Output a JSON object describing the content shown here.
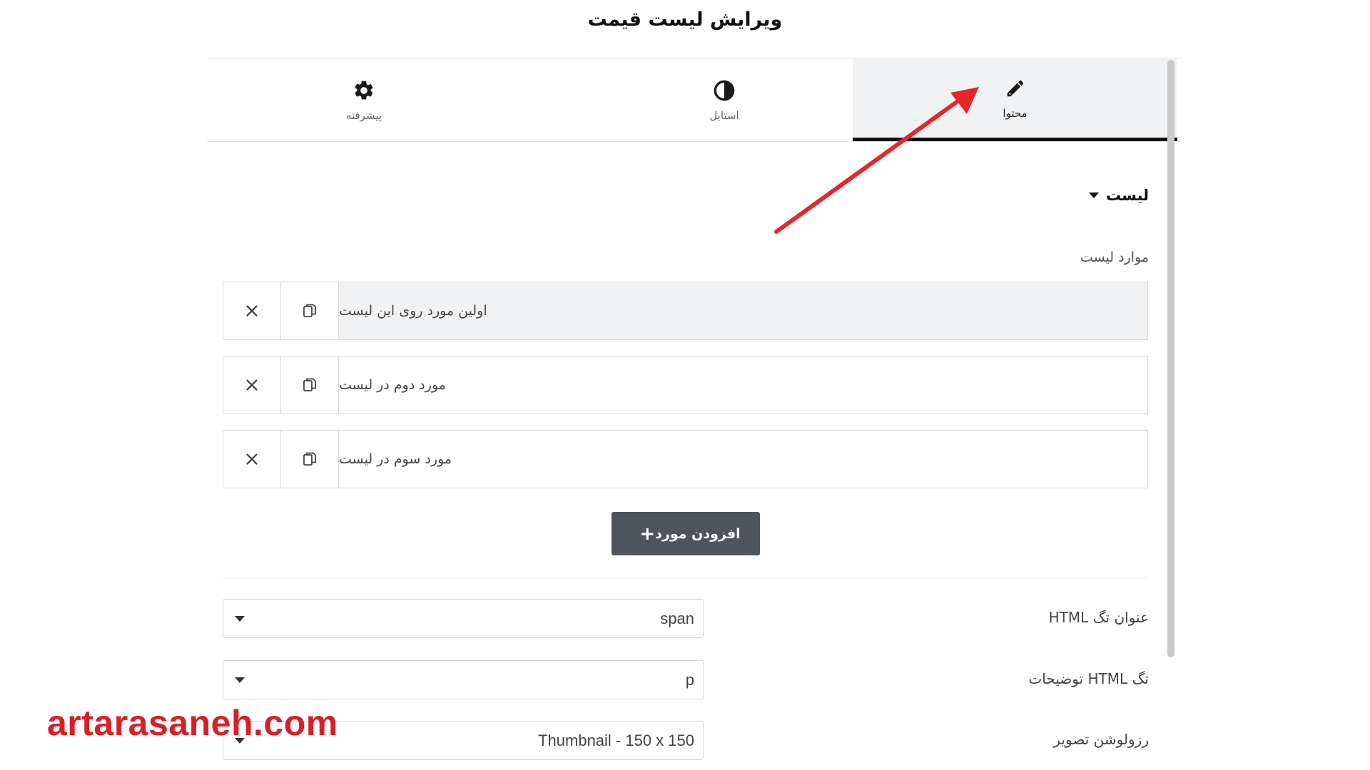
{
  "page_title": "ویرایش لیست قیمت",
  "tabs": [
    {
      "label": "محتوا",
      "icon": "pencil-icon",
      "active": true
    },
    {
      "label": "استایل",
      "icon": "contrast-icon",
      "active": false
    },
    {
      "label": "پیشرفته",
      "icon": "gear-icon",
      "active": false
    }
  ],
  "section": {
    "title": "لیست"
  },
  "items_label": "موارد لیست",
  "items": [
    {
      "title": "اولین مورد روی این لیست"
    },
    {
      "title": "مورد دوم در لیست"
    },
    {
      "title": "مورد سوم در لیست"
    }
  ],
  "add_button": {
    "label": "افزودن مورد"
  },
  "controls": [
    {
      "label": "عنوان تگ HTML",
      "value": "span"
    },
    {
      "label": "تگ HTML توضیحات",
      "value": "p"
    },
    {
      "label": "رزولوشن تصویر",
      "value": "Thumbnail - 150 x 150"
    }
  ],
  "watermark": "artarasaneh.com",
  "colors": {
    "annotation_arrow": "#e8262a",
    "watermark": "#d81f26",
    "button_bg": "#4f545b",
    "active_tab_bg": "#f1f2f3"
  }
}
